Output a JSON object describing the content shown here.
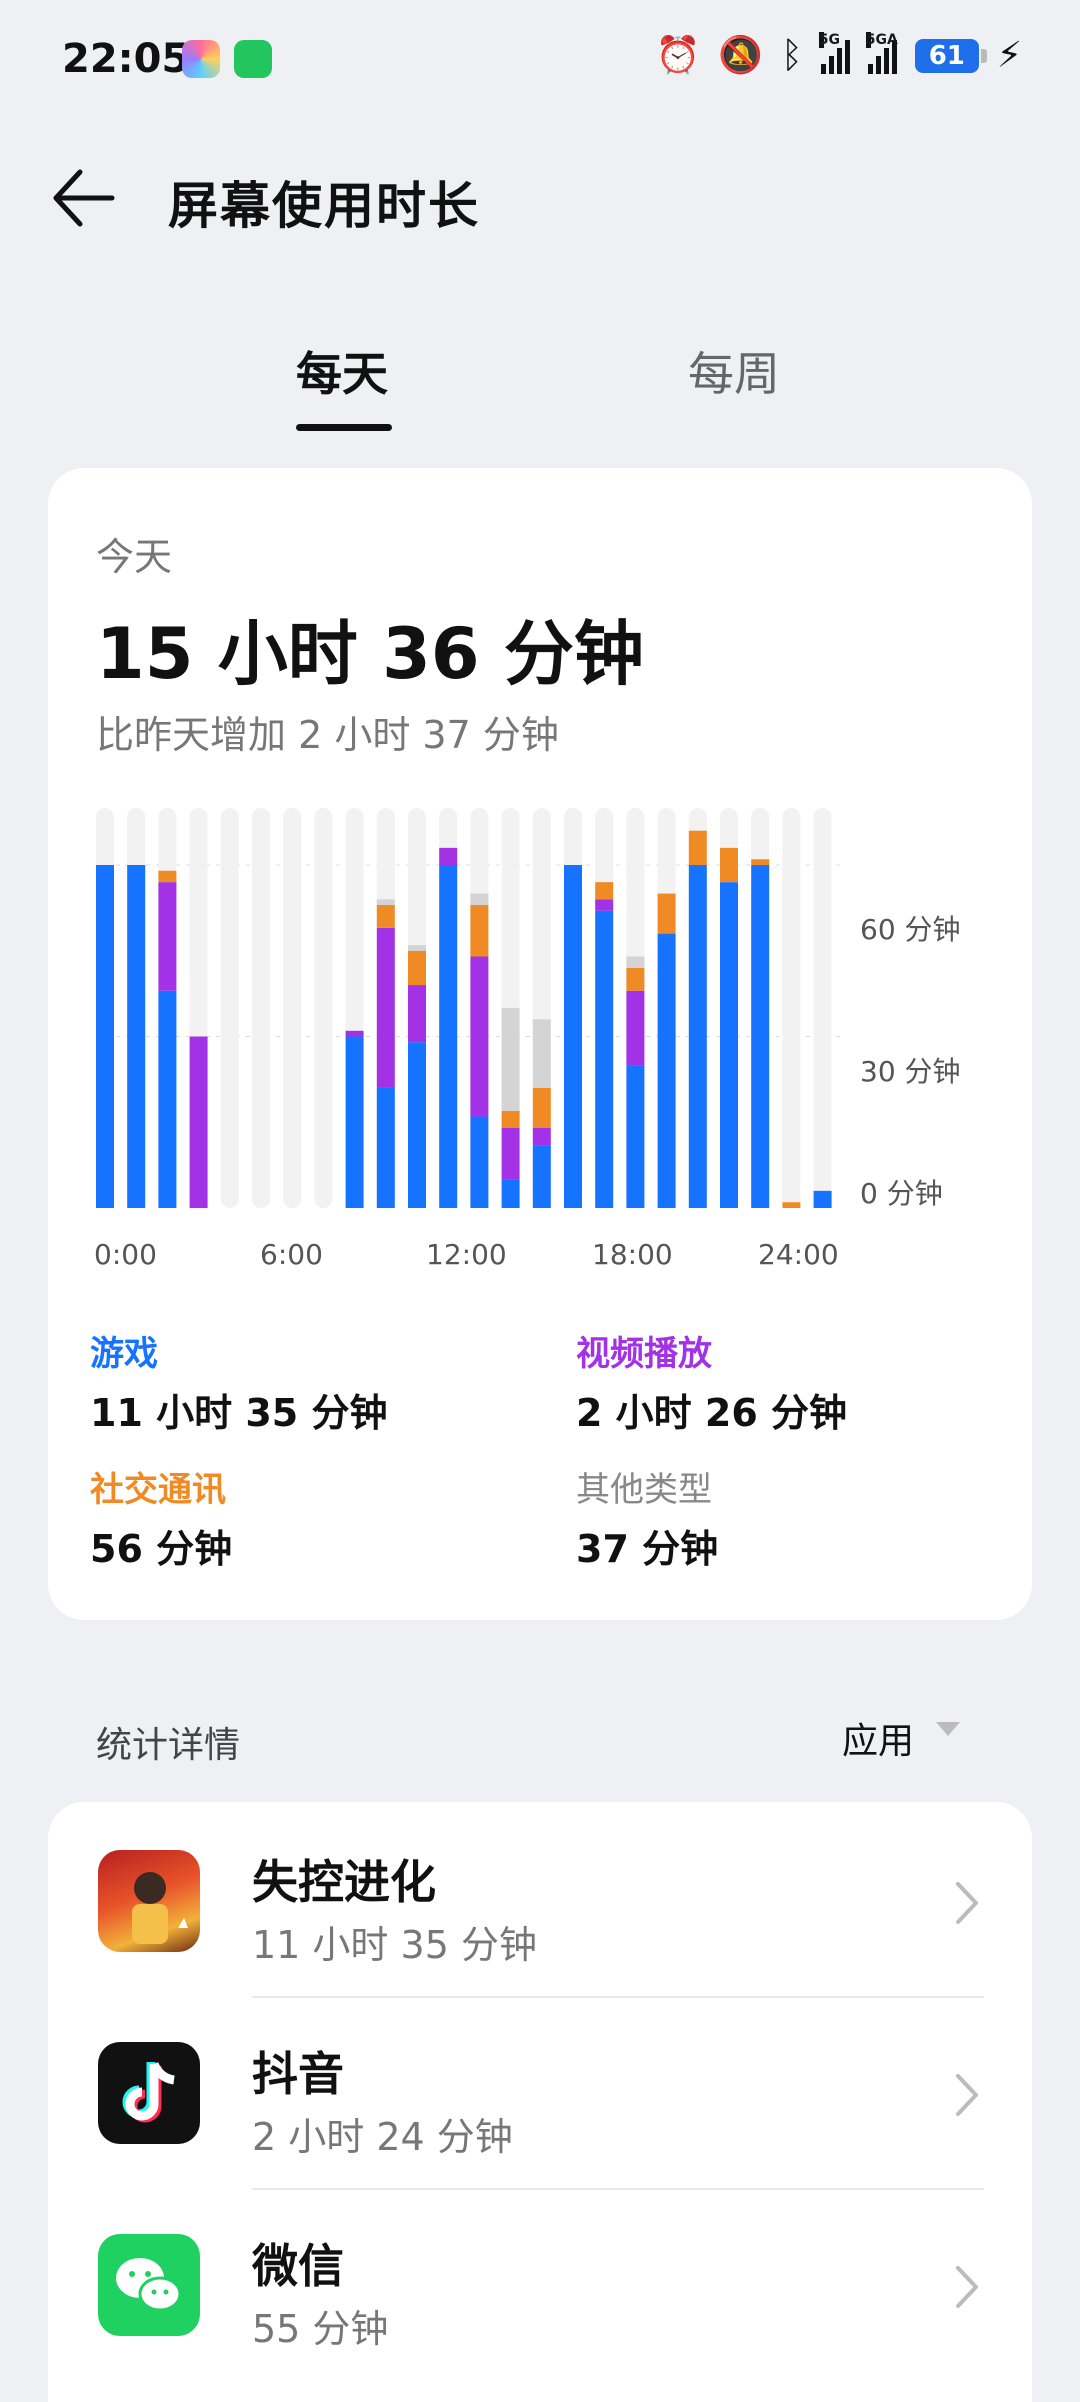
{
  "status_bar": {
    "time": "22:05",
    "network_1": "5G",
    "network_2": "5GA",
    "battery": "61",
    "icons": [
      "alarm-icon",
      "mute-icon",
      "bluetooth-icon",
      "signal-icon",
      "signal-icon",
      "battery-icon",
      "charging-icon"
    ]
  },
  "header": {
    "title": "屏幕使用时长",
    "back_icon": "arrow-left-icon"
  },
  "tabs": [
    {
      "label": "每天",
      "active": true
    },
    {
      "label": "每周",
      "active": false
    }
  ],
  "summary": {
    "day_label": "今天",
    "total": "15 小时 36 分钟",
    "comparison": "比昨天增加 2 小时 37 分钟"
  },
  "colors": {
    "game": "#1673ff",
    "video": "#a332e6",
    "social": "#f08a24",
    "other": "#d4d4d4",
    "track": "#f2f2f2"
  },
  "chart_data": {
    "type": "bar",
    "stacked": true,
    "x_ticks": [
      "0:00",
      "6:00",
      "12:00",
      "18:00",
      "24:00"
    ],
    "y_ticks": [
      "60 分钟",
      "30 分钟",
      "0 分钟"
    ],
    "ylim": [
      0,
      60
    ],
    "categories": [
      "0",
      "1",
      "2",
      "3",
      "4",
      "5",
      "6",
      "7",
      "8",
      "9",
      "10",
      "11",
      "12",
      "13",
      "14",
      "15",
      "16",
      "17",
      "18",
      "19",
      "20",
      "21",
      "22",
      "23"
    ],
    "series": [
      {
        "name": "游戏",
        "values": [
          60,
          60,
          38,
          0,
          0,
          0,
          0,
          0,
          30,
          21,
          29,
          60,
          16,
          5,
          11,
          60,
          52,
          25,
          48,
          60,
          57,
          60,
          0,
          3
        ]
      },
      {
        "name": "视频播放",
        "values": [
          0,
          0,
          19,
          30,
          0,
          0,
          0,
          0,
          1,
          28,
          10,
          3,
          28,
          9,
          3,
          0,
          2,
          13,
          0,
          0,
          0,
          0,
          0,
          0
        ]
      },
      {
        "name": "社交通讯",
        "values": [
          0,
          0,
          2,
          0,
          0,
          0,
          0,
          0,
          0,
          4,
          6,
          0,
          9,
          3,
          7,
          0,
          3,
          4,
          7,
          6,
          6,
          1,
          1,
          0
        ]
      },
      {
        "name": "其他类型",
        "values": [
          0,
          0,
          0,
          0,
          0,
          0,
          0,
          0,
          0,
          1,
          1,
          0,
          2,
          18,
          12,
          0,
          0,
          2,
          0,
          0,
          0,
          0,
          0,
          0
        ]
      }
    ]
  },
  "categories_summary": [
    {
      "name": "游戏",
      "value": "11 小时 35 分钟",
      "color": "#1673ff"
    },
    {
      "name": "视频播放",
      "value": "2 小时 26 分钟",
      "color": "#a332e6"
    },
    {
      "name": "社交通讯",
      "value": "56 分钟",
      "color": "#f08a24"
    },
    {
      "name": "其他类型",
      "value": "37 分钟",
      "color": "#888888"
    }
  ],
  "details": {
    "title": "统计详情",
    "sort_label": "应用",
    "apps": [
      {
        "name": "失控进化",
        "time": "11 小时 35 分钟",
        "icon": "game-app-icon"
      },
      {
        "name": "抖音",
        "time": "2 小时 24 分钟",
        "icon": "tiktok-icon"
      },
      {
        "name": "微信",
        "time": "55 分钟",
        "icon": "wechat-icon"
      }
    ]
  }
}
